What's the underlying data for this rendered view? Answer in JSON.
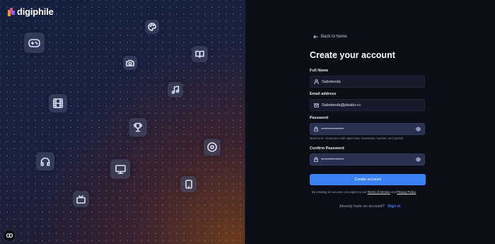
{
  "brand": {
    "name": "digiphile"
  },
  "hero_icons": [
    "gamepad-icon",
    "palette-icon",
    "camera-icon",
    "book-icon",
    "music-icon",
    "film-icon",
    "trophy-icon",
    "disc-icon",
    "headphones-icon",
    "monitor-icon",
    "tablet-icon",
    "tv-icon"
  ],
  "form": {
    "back_label": "Back to home",
    "title": "Create your account",
    "full_name": {
      "label": "Full Name",
      "value": "Sabotenda"
    },
    "email": {
      "label": "Email address",
      "value": "Sabotenda@pikabu.ru"
    },
    "password": {
      "label": "Password",
      "value": "••••••••••••••",
      "hint": "Must be 8+ characters with uppercase, lowercase, number, and symbol"
    },
    "confirm_password": {
      "label": "Confirm Password",
      "value": "••••••••••••••"
    },
    "submit_label": "Create account",
    "terms": {
      "prefix": "By creating an account, you agree to our",
      "tos": "Terms of Service",
      "and": "and",
      "privacy": "Privacy Policy"
    },
    "signin": {
      "prompt": "Already have an account?",
      "link": "Sign in"
    }
  },
  "colors": {
    "accent": "#3b82f6",
    "background": "#0b0d17",
    "field": "#161a2b"
  }
}
